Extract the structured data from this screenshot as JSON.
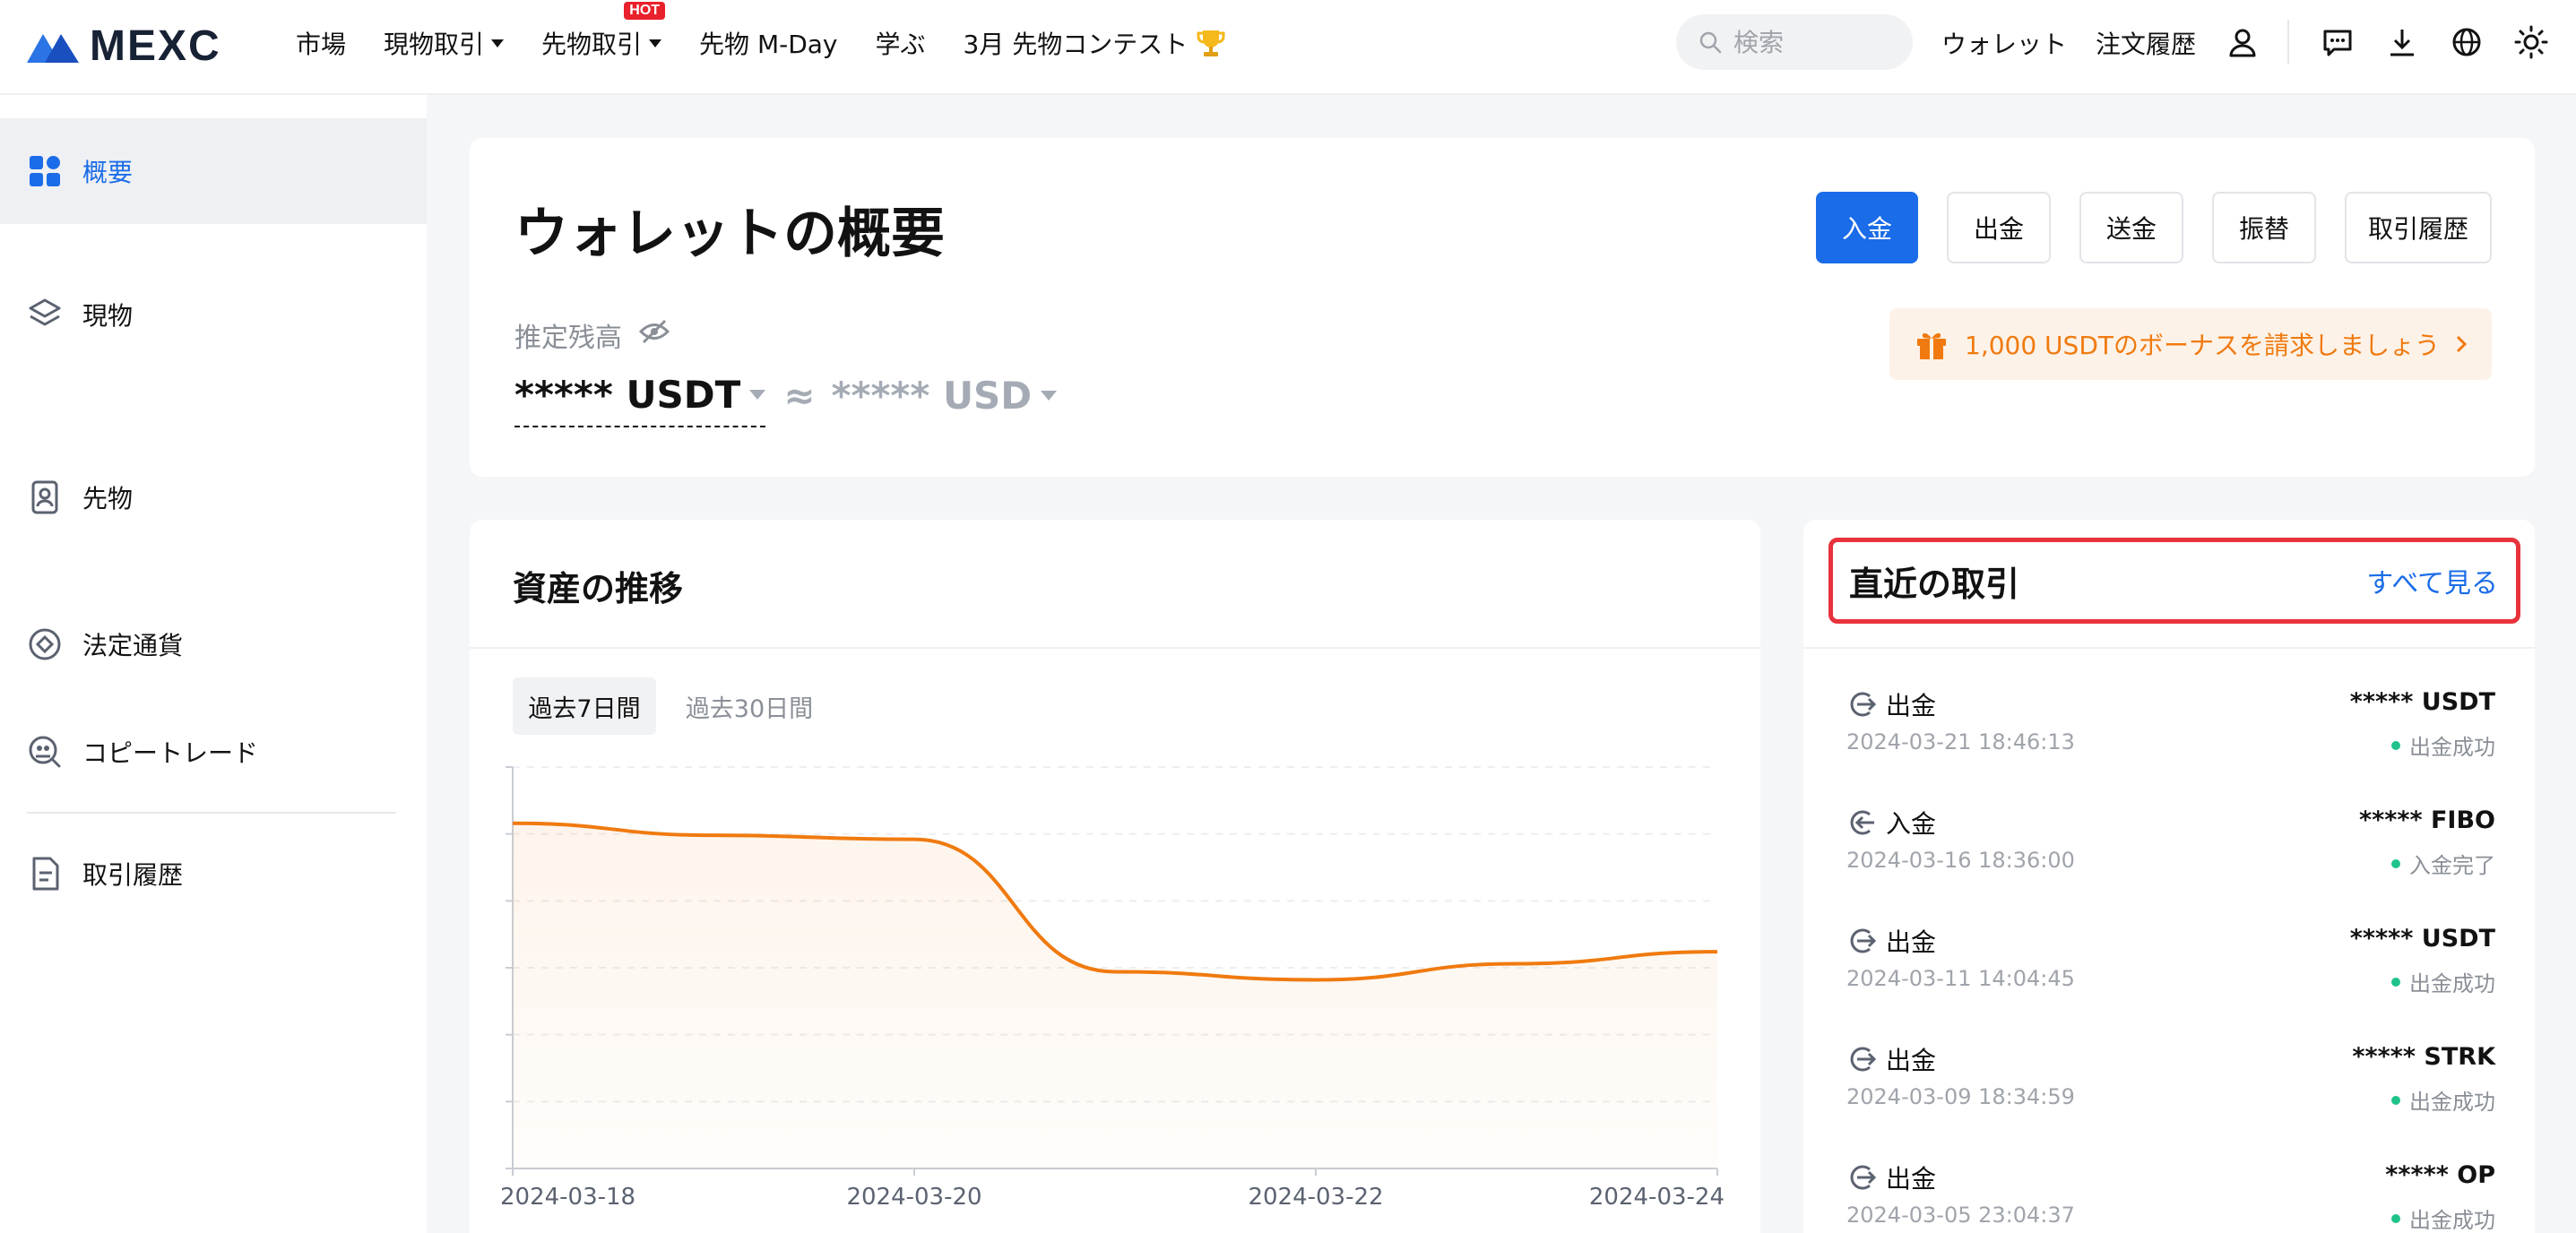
{
  "header": {
    "logo": "MEXC",
    "nav": [
      {
        "label": "市場",
        "caret": false,
        "badge": ""
      },
      {
        "label": "現物取引",
        "caret": true,
        "badge": ""
      },
      {
        "label": "先物取引",
        "caret": true,
        "badge": "HOT"
      },
      {
        "label": "先物 M-Day",
        "caret": false,
        "badge": ""
      },
      {
        "label": "学ぶ",
        "caret": false,
        "badge": ""
      },
      {
        "label": "3月 先物コンテスト",
        "caret": false,
        "badge": "",
        "icon": "trophy-icon"
      }
    ],
    "search_placeholder": "検索",
    "wallet_link": "ウォレット",
    "orders_link": "注文履歴",
    "icons": [
      "user-icon",
      "message-icon",
      "download-icon",
      "globe-icon",
      "theme-icon"
    ]
  },
  "sidebar": {
    "items": [
      {
        "label": "概要",
        "icon": "overview-grid-icon",
        "active": true
      },
      {
        "label": "現物",
        "icon": "spot-layers-icon",
        "active": false
      },
      {
        "label": "先物",
        "icon": "futures-icon",
        "active": false
      },
      {
        "label": "法定通貨",
        "icon": "fiat-icon",
        "active": false
      },
      {
        "label": "コピートレード",
        "icon": "copy-trade-icon",
        "active": false
      },
      {
        "label": "取引履歴",
        "icon": "history-doc-icon",
        "active": false
      }
    ]
  },
  "overview": {
    "title": "ウォレットの概要",
    "buttons": {
      "deposit": "入金",
      "withdraw": "出金",
      "send": "送金",
      "transfer": "振替",
      "history": "取引履歴"
    },
    "estimated_label": "推定残高",
    "balance_usdt": "***** USDT",
    "approx": "≈",
    "balance_usd": "***** USD",
    "bonus_text": "1,000 USDTのボーナスを請求しましょう",
    "accent_color": "#1a6ce8",
    "bonus_color": "#f07a0f"
  },
  "assets": {
    "title": "資産の推移",
    "periods": {
      "week": "過去7日間",
      "month": "過去30日間"
    }
  },
  "chart_data": {
    "type": "area",
    "title": "",
    "xlabel": "",
    "ylabel": "",
    "x": [
      "2024-03-18",
      "2024-03-19",
      "2024-03-20",
      "2024-03-21",
      "2024-03-22",
      "2024-03-23",
      "2024-03-24"
    ],
    "x_tick_labels": [
      "2024-03-18",
      "2024-03-20",
      "2024-03-22",
      "2024-03-24"
    ],
    "values": [
      0.86,
      0.83,
      0.82,
      0.49,
      0.47,
      0.51,
      0.54
    ],
    "ylim": [
      0,
      1
    ],
    "y_tick_labels_shown": false,
    "grid": true,
    "series_color": "#f07a0f"
  },
  "recent": {
    "title": "直近の取引",
    "see_all": "すべて見る",
    "transactions": [
      {
        "type": "出金",
        "time": "2024-03-21 18:46:13",
        "amount": "***** USDT",
        "status": "出金成功",
        "direction": "out"
      },
      {
        "type": "入金",
        "time": "2024-03-16 18:36:00",
        "amount": "***** FIBO",
        "status": "入金完了",
        "direction": "in"
      },
      {
        "type": "出金",
        "time": "2024-03-11 14:04:45",
        "amount": "***** USDT",
        "status": "出金成功",
        "direction": "out"
      },
      {
        "type": "出金",
        "time": "2024-03-09 18:34:59",
        "amount": "***** STRK",
        "status": "出金成功",
        "direction": "out"
      },
      {
        "type": "出金",
        "time": "2024-03-05 23:04:37",
        "amount": "***** OP",
        "status": "出金成功",
        "direction": "out"
      }
    ],
    "status_color": "#1fc38a"
  }
}
